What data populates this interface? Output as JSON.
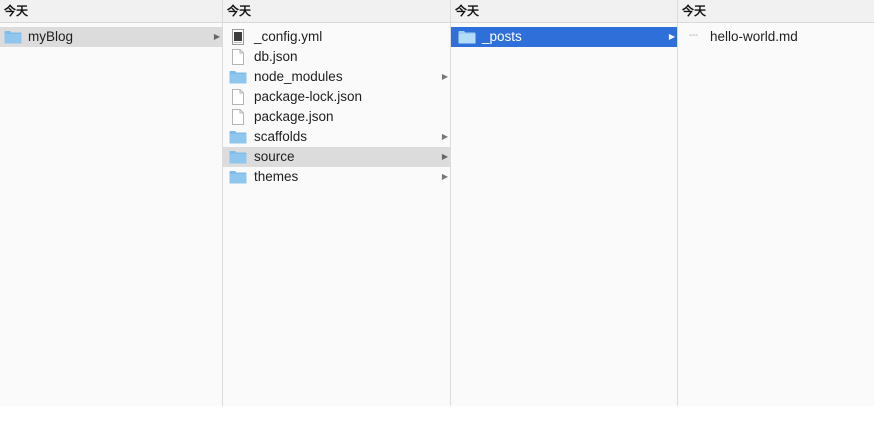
{
  "columns": [
    {
      "header": "今天",
      "items": [
        {
          "label": "myBlog",
          "icon": "folder-icon",
          "has_children": true,
          "selected": "gray"
        }
      ]
    },
    {
      "header": "今天",
      "items": [
        {
          "label": "_config.yml",
          "icon": "yml-file-icon",
          "has_children": false,
          "selected": ""
        },
        {
          "label": "db.json",
          "icon": "document-icon",
          "has_children": false,
          "selected": ""
        },
        {
          "label": "node_modules",
          "icon": "folder-icon",
          "has_children": true,
          "selected": ""
        },
        {
          "label": "package-lock.json",
          "icon": "document-icon",
          "has_children": false,
          "selected": ""
        },
        {
          "label": "package.json",
          "icon": "document-icon",
          "has_children": false,
          "selected": ""
        },
        {
          "label": "scaffolds",
          "icon": "folder-icon",
          "has_children": true,
          "selected": ""
        },
        {
          "label": "source",
          "icon": "folder-icon",
          "has_children": true,
          "selected": "gray"
        },
        {
          "label": "themes",
          "icon": "folder-icon",
          "has_children": true,
          "selected": ""
        }
      ]
    },
    {
      "header": "今天",
      "items": [
        {
          "label": "_posts",
          "icon": "folder-icon",
          "has_children": true,
          "selected": "blue"
        }
      ]
    },
    {
      "header": "今天",
      "items": [
        {
          "label": "hello-world.md",
          "icon": "markdown-file-icon",
          "has_children": false,
          "selected": ""
        }
      ]
    }
  ],
  "arrow_glyph": "▶",
  "colors": {
    "folder": "#7fbce9",
    "selection_blue": "#2f6fd9",
    "selection_gray": "#dcdcdc"
  }
}
